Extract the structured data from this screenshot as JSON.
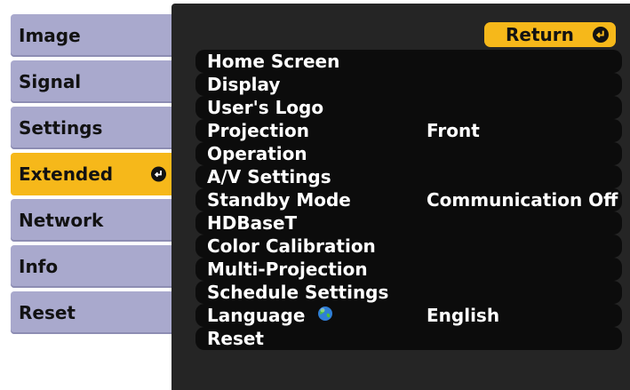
{
  "sidebar": {
    "tabs": [
      {
        "label": "Image",
        "active": false
      },
      {
        "label": "Signal",
        "active": false
      },
      {
        "label": "Settings",
        "active": false
      },
      {
        "label": "Extended",
        "active": true,
        "icon": "enter-icon"
      },
      {
        "label": "Network",
        "active": false
      },
      {
        "label": "Info",
        "active": false
      },
      {
        "label": "Reset",
        "active": false
      }
    ]
  },
  "panel": {
    "return_label": "Return",
    "return_icon": "enter-icon",
    "items": [
      {
        "label": "Home Screen",
        "value": ""
      },
      {
        "label": "Display",
        "value": ""
      },
      {
        "label": "User's Logo",
        "value": ""
      },
      {
        "label": "Projection",
        "value": "Front"
      },
      {
        "label": "Operation",
        "value": ""
      },
      {
        "label": "A/V Settings",
        "value": ""
      },
      {
        "label": "Standby Mode",
        "value": "Communication Off"
      },
      {
        "label": "HDBaseT",
        "value": ""
      },
      {
        "label": "Color Calibration",
        "value": ""
      },
      {
        "label": "Multi-Projection",
        "value": ""
      },
      {
        "label": "Schedule Settings",
        "value": ""
      },
      {
        "label": "Language",
        "value": "English",
        "icon": "globe-icon"
      },
      {
        "label": "Reset",
        "value": ""
      }
    ]
  },
  "colors": {
    "accent": "#f6b81a",
    "tab_bg": "#a9a9cd",
    "panel_bg": "#252525",
    "row_bg": "#0c0c0c",
    "text_light": "#ffffff",
    "text_dark": "#121212"
  }
}
